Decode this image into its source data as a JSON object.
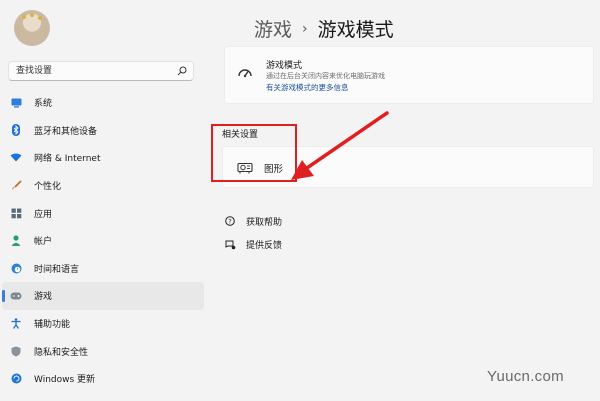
{
  "sidebar": {
    "search_placeholder": "查找设置",
    "items": [
      {
        "label": "系统",
        "icon": "monitor-icon",
        "active": false
      },
      {
        "label": "蓝牙和其他设备",
        "icon": "bluetooth-icon",
        "active": false
      },
      {
        "label": "网络 & Internet",
        "icon": "wifi-icon",
        "active": false
      },
      {
        "label": "个性化",
        "icon": "brush-icon",
        "active": false
      },
      {
        "label": "应用",
        "icon": "apps-icon",
        "active": false
      },
      {
        "label": "帐户",
        "icon": "person-icon",
        "active": false
      },
      {
        "label": "时间和语言",
        "icon": "globe-clock-icon",
        "active": false
      },
      {
        "label": "游戏",
        "icon": "gamepad-icon",
        "active": true
      },
      {
        "label": "辅助功能",
        "icon": "accessibility-icon",
        "active": false
      },
      {
        "label": "隐私和安全性",
        "icon": "shield-icon",
        "active": false
      },
      {
        "label": "Windows 更新",
        "icon": "update-icon",
        "active": false
      }
    ]
  },
  "header": {
    "parent": "游戏",
    "separator": "›",
    "title": "游戏模式"
  },
  "game_mode_card": {
    "title": "游戏模式",
    "description": "通过在后台关闭内容来优化电脑玩游戏",
    "link": "有关游戏模式的更多信息"
  },
  "related": {
    "section_title": "相关设置",
    "graphics_label": "图形"
  },
  "help_links": {
    "get_help": "获取帮助",
    "feedback": "提供反馈"
  },
  "colors": {
    "accent": "#3a7bd5",
    "annotation": "#e02020",
    "background": "#f3f3f3"
  },
  "watermark": "Yuucn.com"
}
